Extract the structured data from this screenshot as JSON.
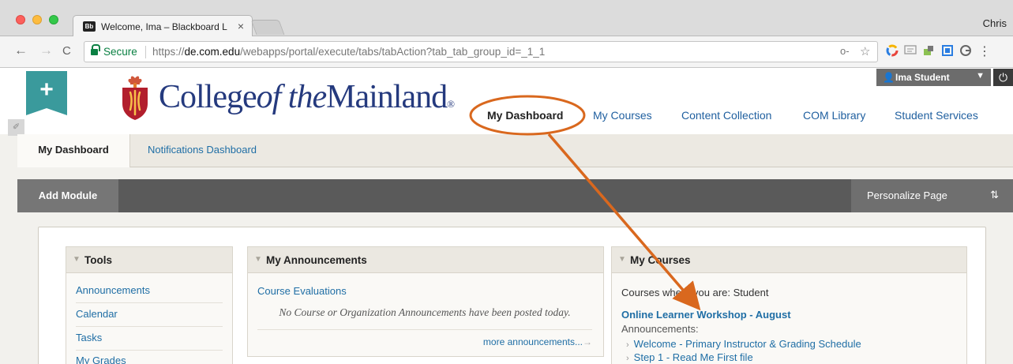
{
  "browser": {
    "tab_favicon": "Bb",
    "tab_title": "Welcome, Ima – Blackboard Le",
    "tab_close": "×",
    "profile_name": "Chris",
    "back_icon": "←",
    "forward_icon": "→",
    "reload_icon": "C",
    "secure_label": "Secure",
    "url_scheme": "https://",
    "url_host": "de.com.edu",
    "url_path": "/webapps/portal/execute/tabs/tabAction?tab_tab_group_id=_1_1",
    "key_icon": "o-",
    "star_icon": "☆",
    "extension_icons": [
      "color-circle-icon",
      "cast-icon",
      "puzzle-icon",
      "window-icon",
      "profile-icon"
    ],
    "menu_icon": "⋮"
  },
  "header": {
    "add_button": "+",
    "pencil_icon": "✐",
    "college_name": {
      "part1": "College",
      "part2": "of the",
      "part3": "Mainland",
      "reg": "®"
    },
    "user": {
      "icon": "👤",
      "name": "Ima Student",
      "caret": "▼"
    },
    "logout_icon": "⏻"
  },
  "top_nav": [
    {
      "label": "My Dashboard",
      "active": true
    },
    {
      "label": "My Courses"
    },
    {
      "label": "Content Collection"
    },
    {
      "label": "COM Library"
    },
    {
      "label": "Student Services"
    }
  ],
  "sub_nav": {
    "active": "My Dashboard",
    "other": "Notifications Dashboard"
  },
  "module_bar": {
    "add_module": "Add Module",
    "personalize": "Personalize Page",
    "sort_icon": "⇅"
  },
  "modules": {
    "tools": {
      "title": "Tools",
      "items": [
        "Announcements",
        "Calendar",
        "Tasks",
        "My Grades"
      ]
    },
    "announcements": {
      "title": "My Announcements",
      "link": "Course Evaluations",
      "empty_message": "No Course or Organization Announcements have been posted today.",
      "more": "more announcements...",
      "more_arrow": "→"
    },
    "courses": {
      "title": "My Courses",
      "role_text": "Courses where you are: Student",
      "course_name": "Online Learner Workshop - August",
      "announcements_label": "Announcements:",
      "items": [
        "Welcome - Primary Instructor & Grading Schedule",
        "Step 1 - Read Me First file"
      ]
    }
  },
  "colors": {
    "annotation": "#d9681e",
    "brand_blue": "#253a7e",
    "teal": "#3a9a9c"
  }
}
